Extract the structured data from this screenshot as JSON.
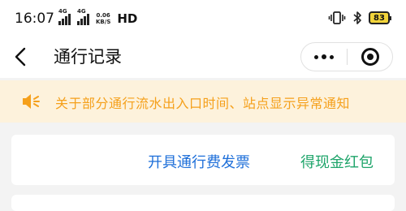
{
  "status_bar": {
    "time": "16:07",
    "signal_1_label": "4G",
    "signal_2_label": "4G",
    "net_speed_value": "0.06",
    "net_speed_unit": "KB/S",
    "hd_label": "HD",
    "vibrate_icon": "vibrate-icon",
    "bluetooth_icon": "bluetooth-icon",
    "battery_level": "83",
    "battery_color": "#f2d43a"
  },
  "navbar": {
    "back_icon": "chevron-left-icon",
    "title": "通行记录",
    "more_icon": "more-dots-icon",
    "close_icon": "target-close-icon"
  },
  "notice": {
    "icon": "speaker-icon",
    "text": "关于部分通行流水出入口时间、站点显示异常通知",
    "color": "#f5a01b",
    "background": "#fdf2dc"
  },
  "actions": {
    "invoice_label": "开具通行费发票",
    "invoice_color": "#1e6fd9",
    "redpack_label": "得现金红包",
    "redpack_color": "#1ea46a"
  }
}
